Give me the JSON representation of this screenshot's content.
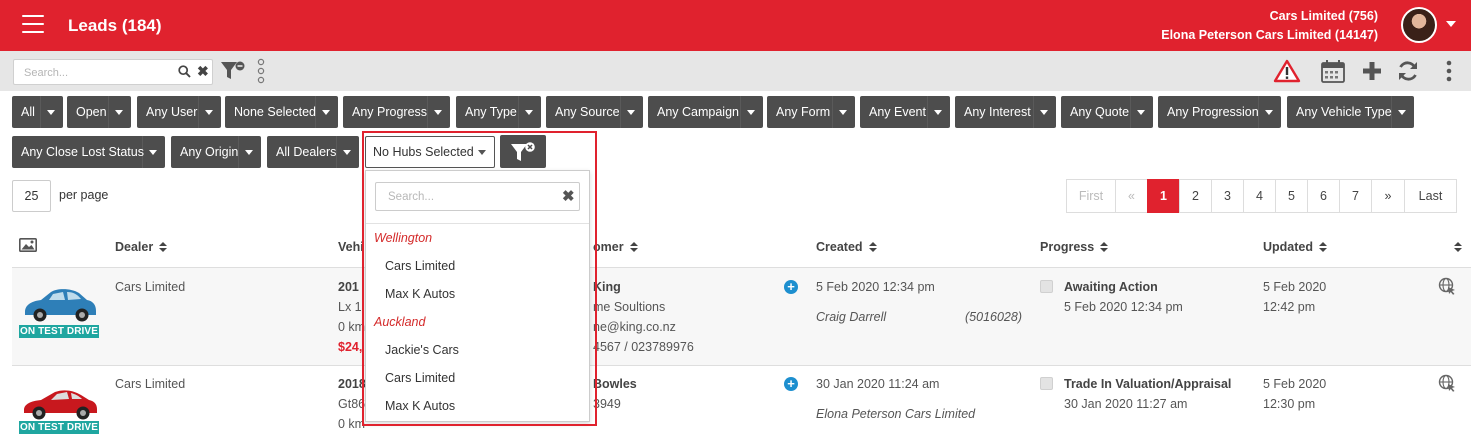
{
  "header": {
    "title": "Leads (184)",
    "account_primary": "Cars Limited (756)",
    "account_secondary": "Elona Peterson Cars Limited (14147)"
  },
  "toolbar": {
    "search_placeholder": "Search...",
    "clear_glyph": "✖"
  },
  "filters": [
    "All",
    "Open",
    "Any User",
    "None Selected",
    "Any Progress",
    "Any Type",
    "Any Source",
    "Any Campaign",
    "Any Form",
    "Any Event",
    "Any Interest",
    "Any Quote",
    "Any Progression",
    "Any Vehicle Type",
    "Any Close Lost Status",
    "Any Origin",
    "All Dealers"
  ],
  "hubs_filter": {
    "selected": "No Hubs Selected",
    "search_placeholder": "Search...",
    "clear_glyph": "✖",
    "groups": [
      {
        "label": "Wellington",
        "options": [
          "Cars Limited",
          "Max K Autos"
        ]
      },
      {
        "label": "Auckland",
        "options": [
          "Jackie's Cars",
          "Cars Limited",
          "Max K Autos"
        ]
      }
    ]
  },
  "per_page": {
    "value": "25",
    "label": "per page"
  },
  "pagination": {
    "first": "First",
    "prev": "«",
    "pages": [
      "1",
      "2",
      "3",
      "4",
      "5",
      "6",
      "7"
    ],
    "active": "1",
    "next": "»",
    "last": "Last"
  },
  "columns": {
    "dealer": "Dealer",
    "vehicle": "Vehi",
    "customer": "omer",
    "created": "Created",
    "progress": "Progress",
    "updated": "Updated"
  },
  "rows": [
    {
      "badge": "ON TEST DRIVE",
      "car_color": "#2e7fb8",
      "dealer": "Cars Limited",
      "vehicle": [
        "201",
        "Lx 1",
        "0 km",
        "$24,"
      ],
      "customer": [
        "King",
        "me Soultions",
        "ne@king.co.nz",
        "4567 / 023789976"
      ],
      "created_date": "5 Feb 2020 12:34 pm",
      "created_by": "Craig Darrell",
      "created_ref": "(5016028)",
      "progress_status": "Awaiting Action",
      "progress_date": "5 Feb 2020 12:34 pm",
      "updated": [
        "5 Feb 2020",
        "12:42 pm"
      ]
    },
    {
      "badge": "ON TEST DRIVE",
      "car_color": "#c8181e",
      "dealer": "Cars Limited",
      "vehicle": [
        "2018",
        "Gt86",
        "0 km"
      ],
      "customer": [
        "Bowles",
        "3949"
      ],
      "created_date": "30 Jan 2020 11:24 am",
      "created_by": "Elona Peterson Cars Limited",
      "progress_status": "Trade In Valuation/Appraisal",
      "progress_date": "30 Jan 2020 11:27 am",
      "updated": [
        "5 Feb 2020",
        "12:30 pm"
      ]
    }
  ],
  "colors": {
    "brand_red": "#e0222e",
    "filter_dark": "#4d4d4d",
    "badge_teal": "#1fa6a0",
    "plus_blue": "#1d8fcf"
  },
  "icons": {
    "menu": "hamburger-icon",
    "search": "search-icon",
    "filter": "filter-settings-icon",
    "more": "vertical-dots-icon",
    "alert": "warning-icon",
    "calendar": "calendar-icon",
    "add": "plus-icon",
    "refresh": "refresh-icon",
    "kebab": "more-vert-icon",
    "clear_filter": "filter-clear-icon",
    "image": "image-icon",
    "globe": "globe-cursor-icon"
  }
}
